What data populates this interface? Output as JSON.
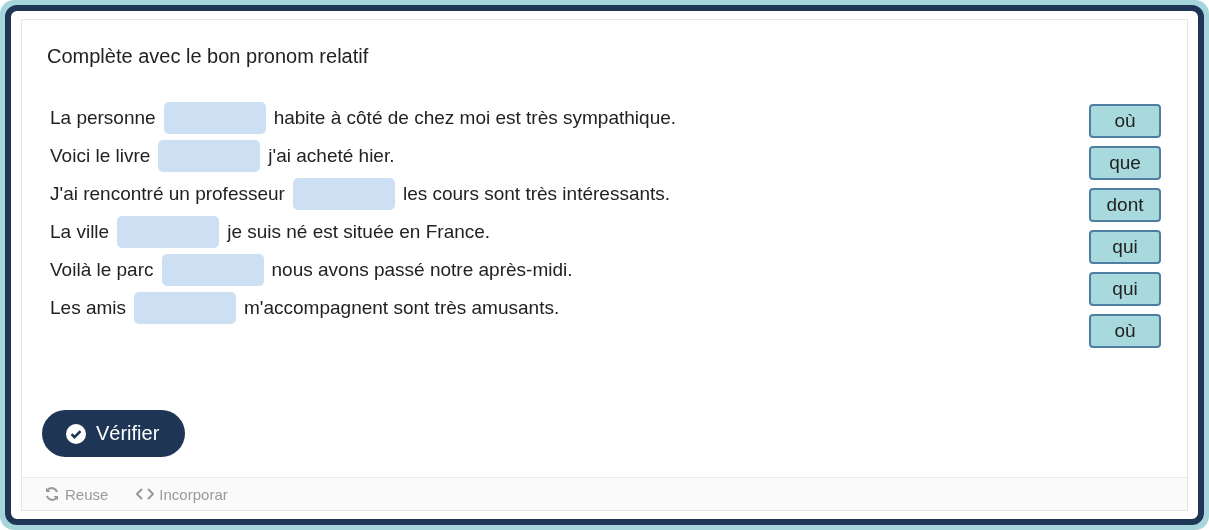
{
  "title": "Complète avec le bon pronom relatif",
  "sentences": [
    {
      "before": "La personne",
      "after": "habite à côté de chez moi est très sympathique."
    },
    {
      "before": "Voici le livre",
      "after": "j'ai acheté hier."
    },
    {
      "before": "J'ai rencontré un professeur",
      "after": "les cours sont très intéressants."
    },
    {
      "before": "La ville",
      "after": "je suis né est située en France."
    },
    {
      "before": "Voilà le parc",
      "after": "nous avons passé notre après-midi."
    },
    {
      "before": "Les amis",
      "after": "m'accompagnent sont très amusants."
    }
  ],
  "words": [
    "où",
    "que",
    "dont",
    "qui",
    "qui",
    "où"
  ],
  "check_button": "Vérifier",
  "footer": [
    {
      "kind": "reuse",
      "label": "Reuse"
    },
    {
      "kind": "embed",
      "label": "Incorporar"
    }
  ]
}
